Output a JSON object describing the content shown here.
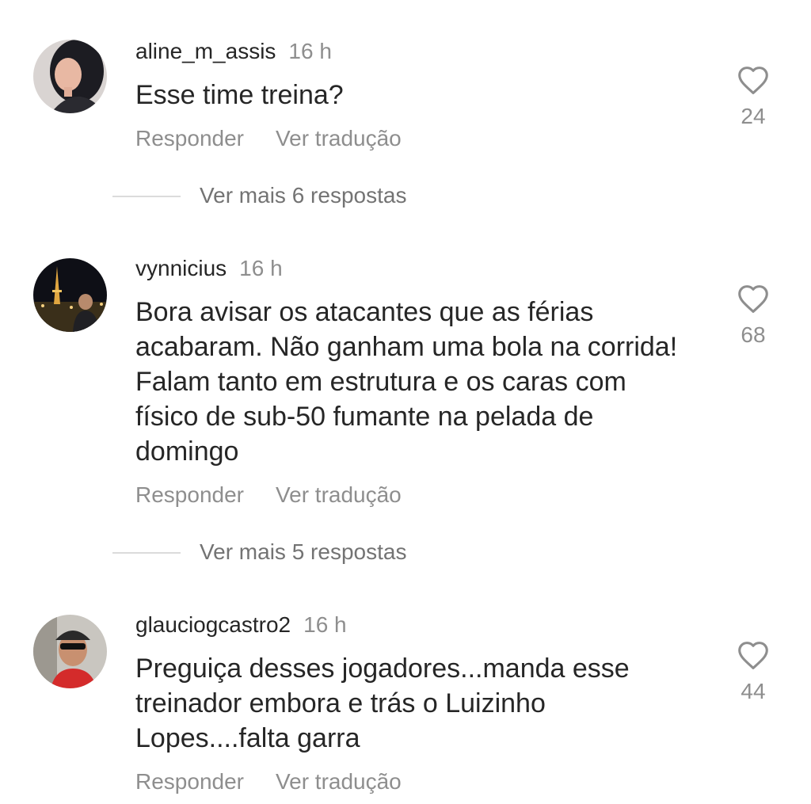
{
  "comments": [
    {
      "username": "aline_m_assis",
      "time": "16 h",
      "text": "Esse time treina?",
      "reply_label": "Responder",
      "translate_label": "Ver tradução",
      "likes": "24",
      "more_replies": "Ver mais 6 respostas",
      "avatar_icon": "profile-photo"
    },
    {
      "username": "vynnicius",
      "time": "16 h",
      "text": "Bora avisar os atacantes que as férias acabaram. Não ganham uma bola na corrida! Falam tanto em estrutura e os caras com físico de sub-50 fumante na pelada de domingo",
      "reply_label": "Responder",
      "translate_label": "Ver tradução",
      "likes": "68",
      "more_replies": "Ver mais 5 respostas",
      "avatar_icon": "profile-photo"
    },
    {
      "username": "glauciogcastro2",
      "time": "16 h",
      "text": "Preguiça desses jogadores...manda esse treinador embora e trás o Luizinho Lopes....falta garra",
      "reply_label": "Responder",
      "translate_label": "Ver tradução",
      "likes": "44",
      "avatar_icon": "profile-photo"
    }
  ],
  "colors": {
    "text_primary": "#262626",
    "text_secondary": "#8e8e8e",
    "divider": "#dbdbdb",
    "background": "#ffffff"
  }
}
